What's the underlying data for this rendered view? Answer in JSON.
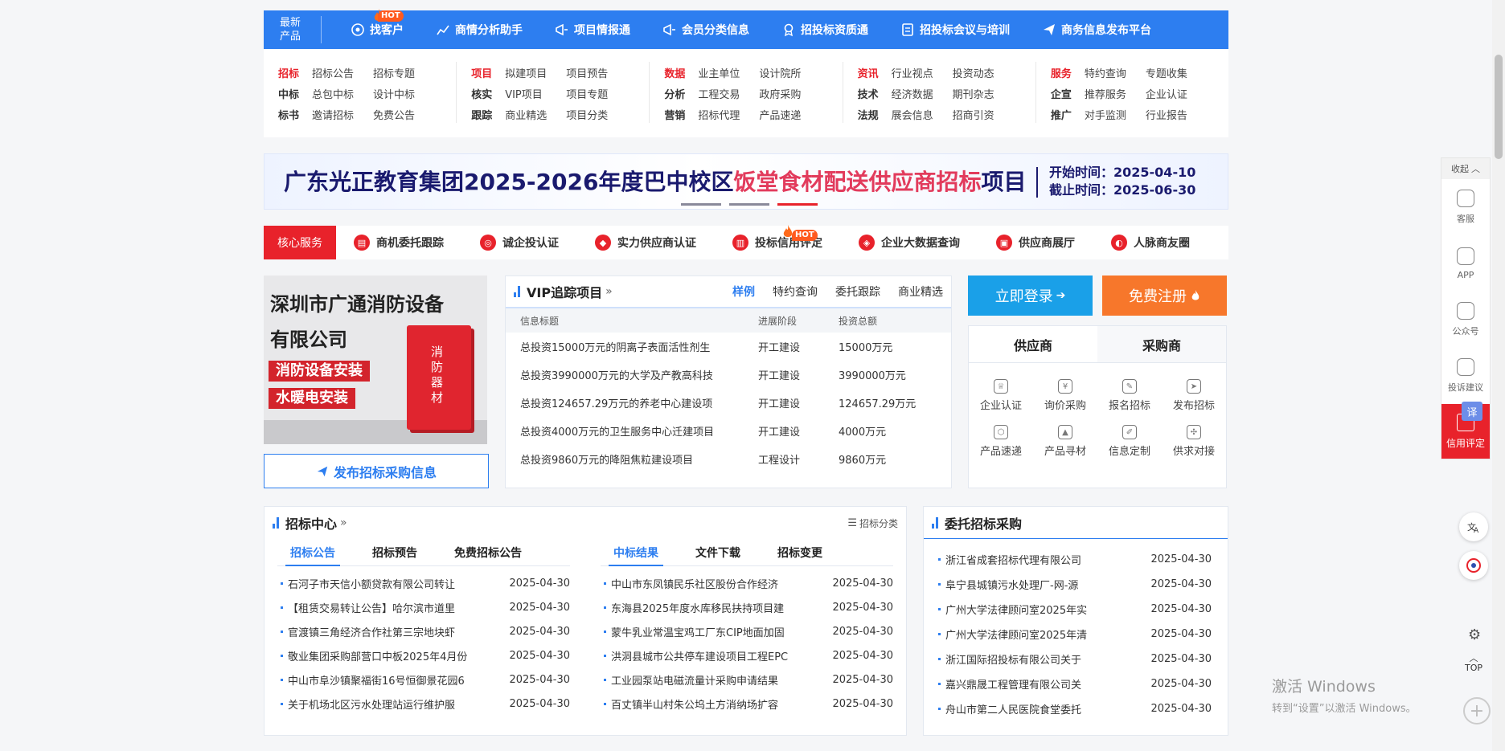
{
  "topnav": {
    "newprod": [
      "最新",
      "产品"
    ],
    "hot": "HOT",
    "items": [
      "找客户",
      "商情分析助手",
      "项目情报通",
      "会员分类信息",
      "招投标资质通",
      "招投标会议与培训",
      "商务信息发布平台"
    ]
  },
  "menu": [
    {
      "rows": [
        {
          "label": "招标",
          "red": true,
          "links": [
            "招标公告",
            "招标专题"
          ]
        },
        {
          "label": "中标",
          "red": false,
          "links": [
            "总包中标",
            "设计中标"
          ]
        },
        {
          "label": "标书",
          "red": false,
          "links": [
            "邀请招标",
            "免费公告"
          ]
        }
      ]
    },
    {
      "rows": [
        {
          "label": "项目",
          "red": true,
          "links": [
            "拟建项目",
            "项目预告"
          ]
        },
        {
          "label": "核实",
          "red": false,
          "links": [
            "VIP项目",
            "项目专题"
          ]
        },
        {
          "label": "跟踪",
          "red": false,
          "links": [
            "商业精选",
            "项目分类"
          ]
        }
      ]
    },
    {
      "rows": [
        {
          "label": "数据",
          "red": true,
          "links": [
            "业主单位",
            "设计院所"
          ]
        },
        {
          "label": "分析",
          "red": false,
          "links": [
            "工程交易",
            "政府采购"
          ]
        },
        {
          "label": "营销",
          "red": false,
          "links": [
            "招标代理",
            "产品速递"
          ]
        }
      ]
    },
    {
      "rows": [
        {
          "label": "资讯",
          "red": true,
          "links": [
            "行业视点",
            "投资动态"
          ]
        },
        {
          "label": "技术",
          "red": false,
          "links": [
            "经济数据",
            "期刊杂志"
          ]
        },
        {
          "label": "法规",
          "red": false,
          "links": [
            "展会信息",
            "招商引资"
          ]
        }
      ]
    },
    {
      "rows": [
        {
          "label": "服务",
          "red": true,
          "links": [
            "特约查询",
            "专题收集"
          ]
        },
        {
          "label": "企宣",
          "red": false,
          "links": [
            "推荐服务",
            "企业认证"
          ]
        },
        {
          "label": "推广",
          "red": false,
          "links": [
            "对手监测",
            "行业报告"
          ]
        }
      ]
    }
  ],
  "banner": {
    "title_a": "广东光正教育集团2025-2026年度巴中校区",
    "title_hl": "饭堂食材配送供应商招标",
    "title_b": "项目",
    "start": "开始时间：2025-04-10",
    "end": "截止时间：2025-06-30"
  },
  "core": {
    "tag": "核心服务",
    "items": [
      "商机委托跟踪",
      "诚企投认证",
      "实力供应商认证",
      "投标信用评定",
      "企业大数据查询",
      "供应商展厅",
      "人脉商友圈"
    ],
    "hot": "HOT"
  },
  "ad": {
    "line1": "深圳市广通消防设备",
    "line2": "有限公司",
    "pill1": "消防设备安装",
    "pill2": "水暖电安装",
    "cabinet": "消防器材",
    "publish": "发布招标采购信息"
  },
  "vip": {
    "title": "VIP追踪项目",
    "tabs": [
      "样例",
      "特约查询",
      "委托跟踪",
      "商业精选"
    ],
    "headers": [
      "信息标题",
      "进展阶段",
      "投资总额"
    ],
    "rows": [
      [
        "总投资15000万元的阴离子表面活性剂生",
        "开工建设",
        "15000万元"
      ],
      [
        "总投资3990000万元的大学及产教高科技",
        "开工建设",
        "3990000万元"
      ],
      [
        "总投资124657.29万元的养老中心建设项",
        "开工建设",
        "124657.29万元"
      ],
      [
        "总投资4000万元的卫生服务中心迁建项目",
        "开工建设",
        "4000万元"
      ],
      [
        "总投资9860万元的降阻焦粒建设项目",
        "工程设计",
        "9860万元"
      ]
    ]
  },
  "login": {
    "login_label": "立即登录",
    "register_label": "免费注册",
    "tabs": [
      "供应商",
      "采购商"
    ],
    "grid": [
      "企业认证",
      "询价采购",
      "报名招标",
      "发布招标",
      "产品速递",
      "产品寻材",
      "信息定制",
      "供求对接"
    ]
  },
  "zb": {
    "title": "招标中心",
    "cat": "招标分类",
    "left_tabs": [
      "招标公告",
      "招标预告",
      "免费招标公告"
    ],
    "right_tabs": [
      "中标结果",
      "文件下载",
      "招标变更"
    ],
    "left": [
      [
        "石河子市天信小额贷款有限公司转让",
        "2025-04-30"
      ],
      [
        "【租赁交易转让公告】哈尔滨市道里",
        "2025-04-30"
      ],
      [
        "官渡镇三角经济合作社第三宗地块虾",
        "2025-04-30"
      ],
      [
        "敬业集团采购部营口中板2025年4月份",
        "2025-04-30"
      ],
      [
        "中山市阜沙镇聚福街16号恒御景花园6",
        "2025-04-30"
      ],
      [
        "关于机场北区污水处理站运行维护服",
        "2025-04-30"
      ]
    ],
    "right": [
      [
        "中山市东凤镇民乐社区股份合作经济",
        "2025-04-30"
      ],
      [
        "东海县2025年度水库移民扶持项目建",
        "2025-04-30"
      ],
      [
        "蒙牛乳业常温宝鸡工厂东CIP地面加固",
        "2025-04-30"
      ],
      [
        "洪洞县城市公共停车建设项目工程EPC",
        "2025-04-30"
      ],
      [
        "工业园泵站电磁流量计采购申请结果",
        "2025-04-30"
      ],
      [
        "百丈镇半山村朱公坞土方消纳场扩容",
        "2025-04-30"
      ]
    ]
  },
  "wt": {
    "title": "委托招标采购",
    "items": [
      [
        "浙江省成套招标代理有限公司",
        "2025-04-30"
      ],
      [
        "阜宁县城镇污水处理厂-网-源",
        "2025-04-30"
      ],
      [
        "广州大学法律顾问室2025年实",
        "2025-04-30"
      ],
      [
        "广州大学法律顾问室2025年清",
        "2025-04-30"
      ],
      [
        "浙江国际招投标有限公司关于",
        "2025-04-30"
      ],
      [
        "嘉兴鼎晟工程管理有限公司关",
        "2025-04-30"
      ],
      [
        "舟山市第二人民医院食堂委托",
        "2025-04-30"
      ]
    ]
  },
  "side": {
    "collapse": "收起",
    "items": [
      "客服",
      "APP",
      "公众号",
      "投诉建议"
    ],
    "credit": "信用评定",
    "translate": "译",
    "top": "TOP"
  },
  "windows": {
    "line1": "激活 Windows",
    "line2": "转到“设置”以激活 Windows。"
  },
  "colors": {
    "primary": "#2d7ef0",
    "red": "#e8222b",
    "orange": "#f7772b",
    "sky": "#1aa0e8"
  }
}
